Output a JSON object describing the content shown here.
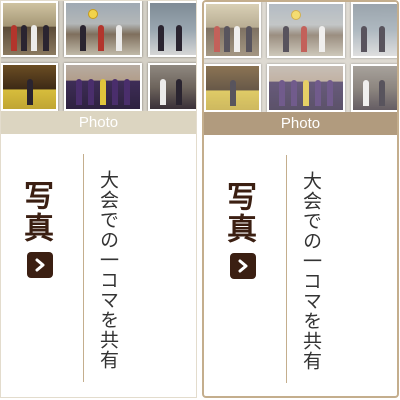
{
  "cards": [
    {
      "photo_label": "Photo",
      "heading": "写真",
      "caption": "大会での一コマを共有",
      "arrow_icon": "chevron-right-icon",
      "state": "normal"
    },
    {
      "photo_label": "Photo",
      "heading": "写真",
      "caption": "大会での一コマを共有",
      "arrow_icon": "chevron-right-icon",
      "state": "hover"
    }
  ],
  "colors": {
    "heading": "#3b1f12",
    "bar_normal": "#dcd5c1",
    "bar_hover": "#b19b7e",
    "border_hover": "#c4ae8d"
  }
}
